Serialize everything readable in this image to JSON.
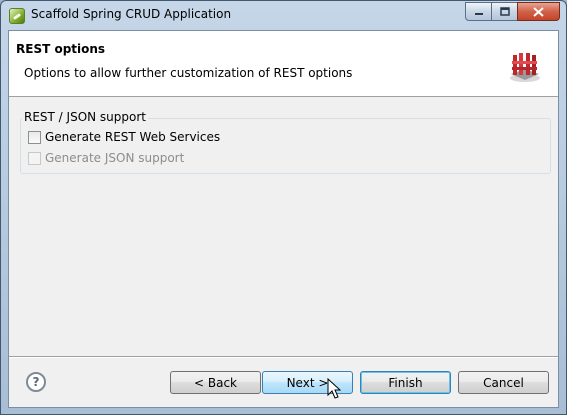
{
  "window": {
    "title": "Scaffold Spring CRUD Application"
  },
  "header": {
    "title": "REST options",
    "description": "Options to allow further customization of REST options"
  },
  "group": {
    "label": "REST / JSON support",
    "options": [
      {
        "label": "Generate REST Web Services",
        "checked": false,
        "enabled": true
      },
      {
        "label": "Generate JSON support",
        "checked": false,
        "enabled": false
      }
    ]
  },
  "footer": {
    "help_icon": "?",
    "back_label": "< Back",
    "next_label": "Next >",
    "finish_label": "Finish",
    "cancel_label": "Cancel"
  },
  "icons": {
    "app": "spring-leaf-icon",
    "banner": "rest-fence-icon",
    "help": "help-icon"
  },
  "colors": {
    "accent": "#3c7fb1",
    "banner_red": "#c0282d"
  }
}
